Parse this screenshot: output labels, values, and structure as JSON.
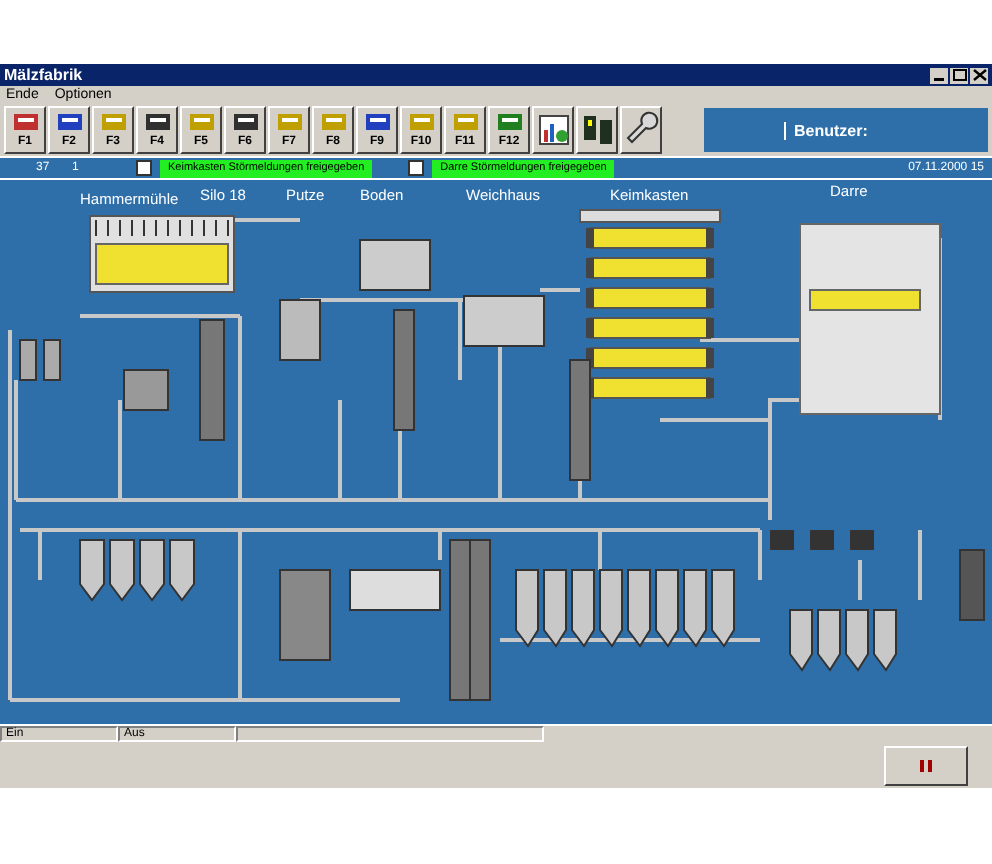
{
  "window": {
    "title": "Mälzfabrik"
  },
  "menu": [
    "Ende",
    "Optionen"
  ],
  "toolbar": {
    "keys": [
      "F1",
      "F2",
      "F3",
      "F4",
      "F5",
      "F6",
      "F7",
      "F8",
      "F9",
      "F10",
      "F11",
      "F12"
    ],
    "user_label": "Benutzer:"
  },
  "info_bar": {
    "counters": [
      "37",
      "1"
    ],
    "alarms": [
      {
        "label": "Keimkasten Störmeldungen freigegeben",
        "checked": false
      },
      {
        "label": "Darre Störmeldungen freigegeben",
        "checked": false
      }
    ],
    "datetime": "07.11.2000 15"
  },
  "sections": [
    "Hammermühle",
    "Silo 18",
    "Putze",
    "Boden",
    "Weichhaus",
    "Keimkasten",
    "Darre"
  ],
  "status_bar": [
    "Ein",
    "Aus"
  ]
}
